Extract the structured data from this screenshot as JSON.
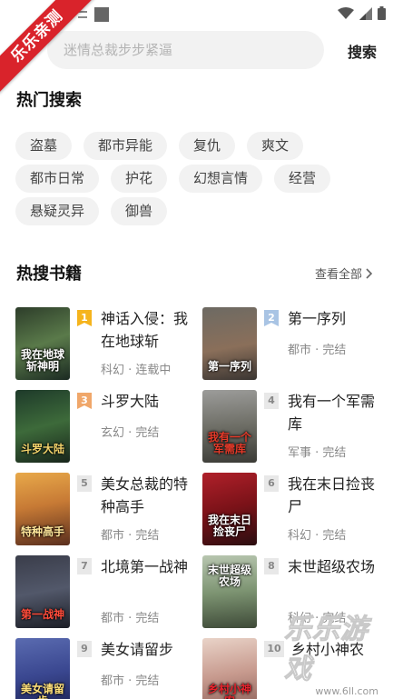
{
  "status_bar": {
    "icons": [
      "notification-icon",
      "app-square-icon",
      "wifi-icon",
      "signal-icon",
      "battery-icon"
    ]
  },
  "ribbon": {
    "text": "乐乐亲测"
  },
  "search": {
    "placeholder": "迷情总裁步步紧逼",
    "button": "搜索"
  },
  "hot_search": {
    "title": "热门搜索",
    "tags": [
      "盗墓",
      "都市异能",
      "复仇",
      "爽文",
      "都市日常",
      "护花",
      "幻想言情",
      "经营",
      "悬疑灵异",
      "御兽"
    ]
  },
  "hot_books": {
    "title": "热搜书籍",
    "view_all": "查看全部",
    "books": [
      {
        "rank": "1",
        "title": "神话入侵：我在地球斩",
        "meta": "科幻 · 连载中",
        "cover_text": "我在地球斩神明"
      },
      {
        "rank": "2",
        "title": "第一序列",
        "meta": "都市 · 完结",
        "cover_text": "第一序列"
      },
      {
        "rank": "3",
        "title": "斗罗大陆",
        "meta": "玄幻 · 完结",
        "cover_text": "斗罗大陆"
      },
      {
        "rank": "4",
        "title": "我有一个军需库",
        "meta": "军事 · 完结",
        "cover_text": "我有一个军需库"
      },
      {
        "rank": "5",
        "title": "美女总裁的特种高手",
        "meta": "都市 · 完结",
        "cover_text": "特种高手"
      },
      {
        "rank": "6",
        "title": "我在末日捡丧尸",
        "meta": "科幻 · 完结",
        "cover_text": "我在末日捡丧尸"
      },
      {
        "rank": "7",
        "title": "北境第一战神",
        "meta": "都市 · 完结",
        "cover_text": "第一战神"
      },
      {
        "rank": "8",
        "title": "末世超级农场",
        "meta": "科幻 · 完结",
        "cover_text": "末世超级农场"
      },
      {
        "rank": "9",
        "title": "美女请留步",
        "meta": "都市 · 完结",
        "cover_text": "美女请留步"
      },
      {
        "rank": "10",
        "title": "乡村小神农",
        "meta": "",
        "cover_text": "乡村小神农"
      }
    ]
  },
  "watermark": {
    "text": "乐乐游戏",
    "url": "www.6ll.com"
  }
}
